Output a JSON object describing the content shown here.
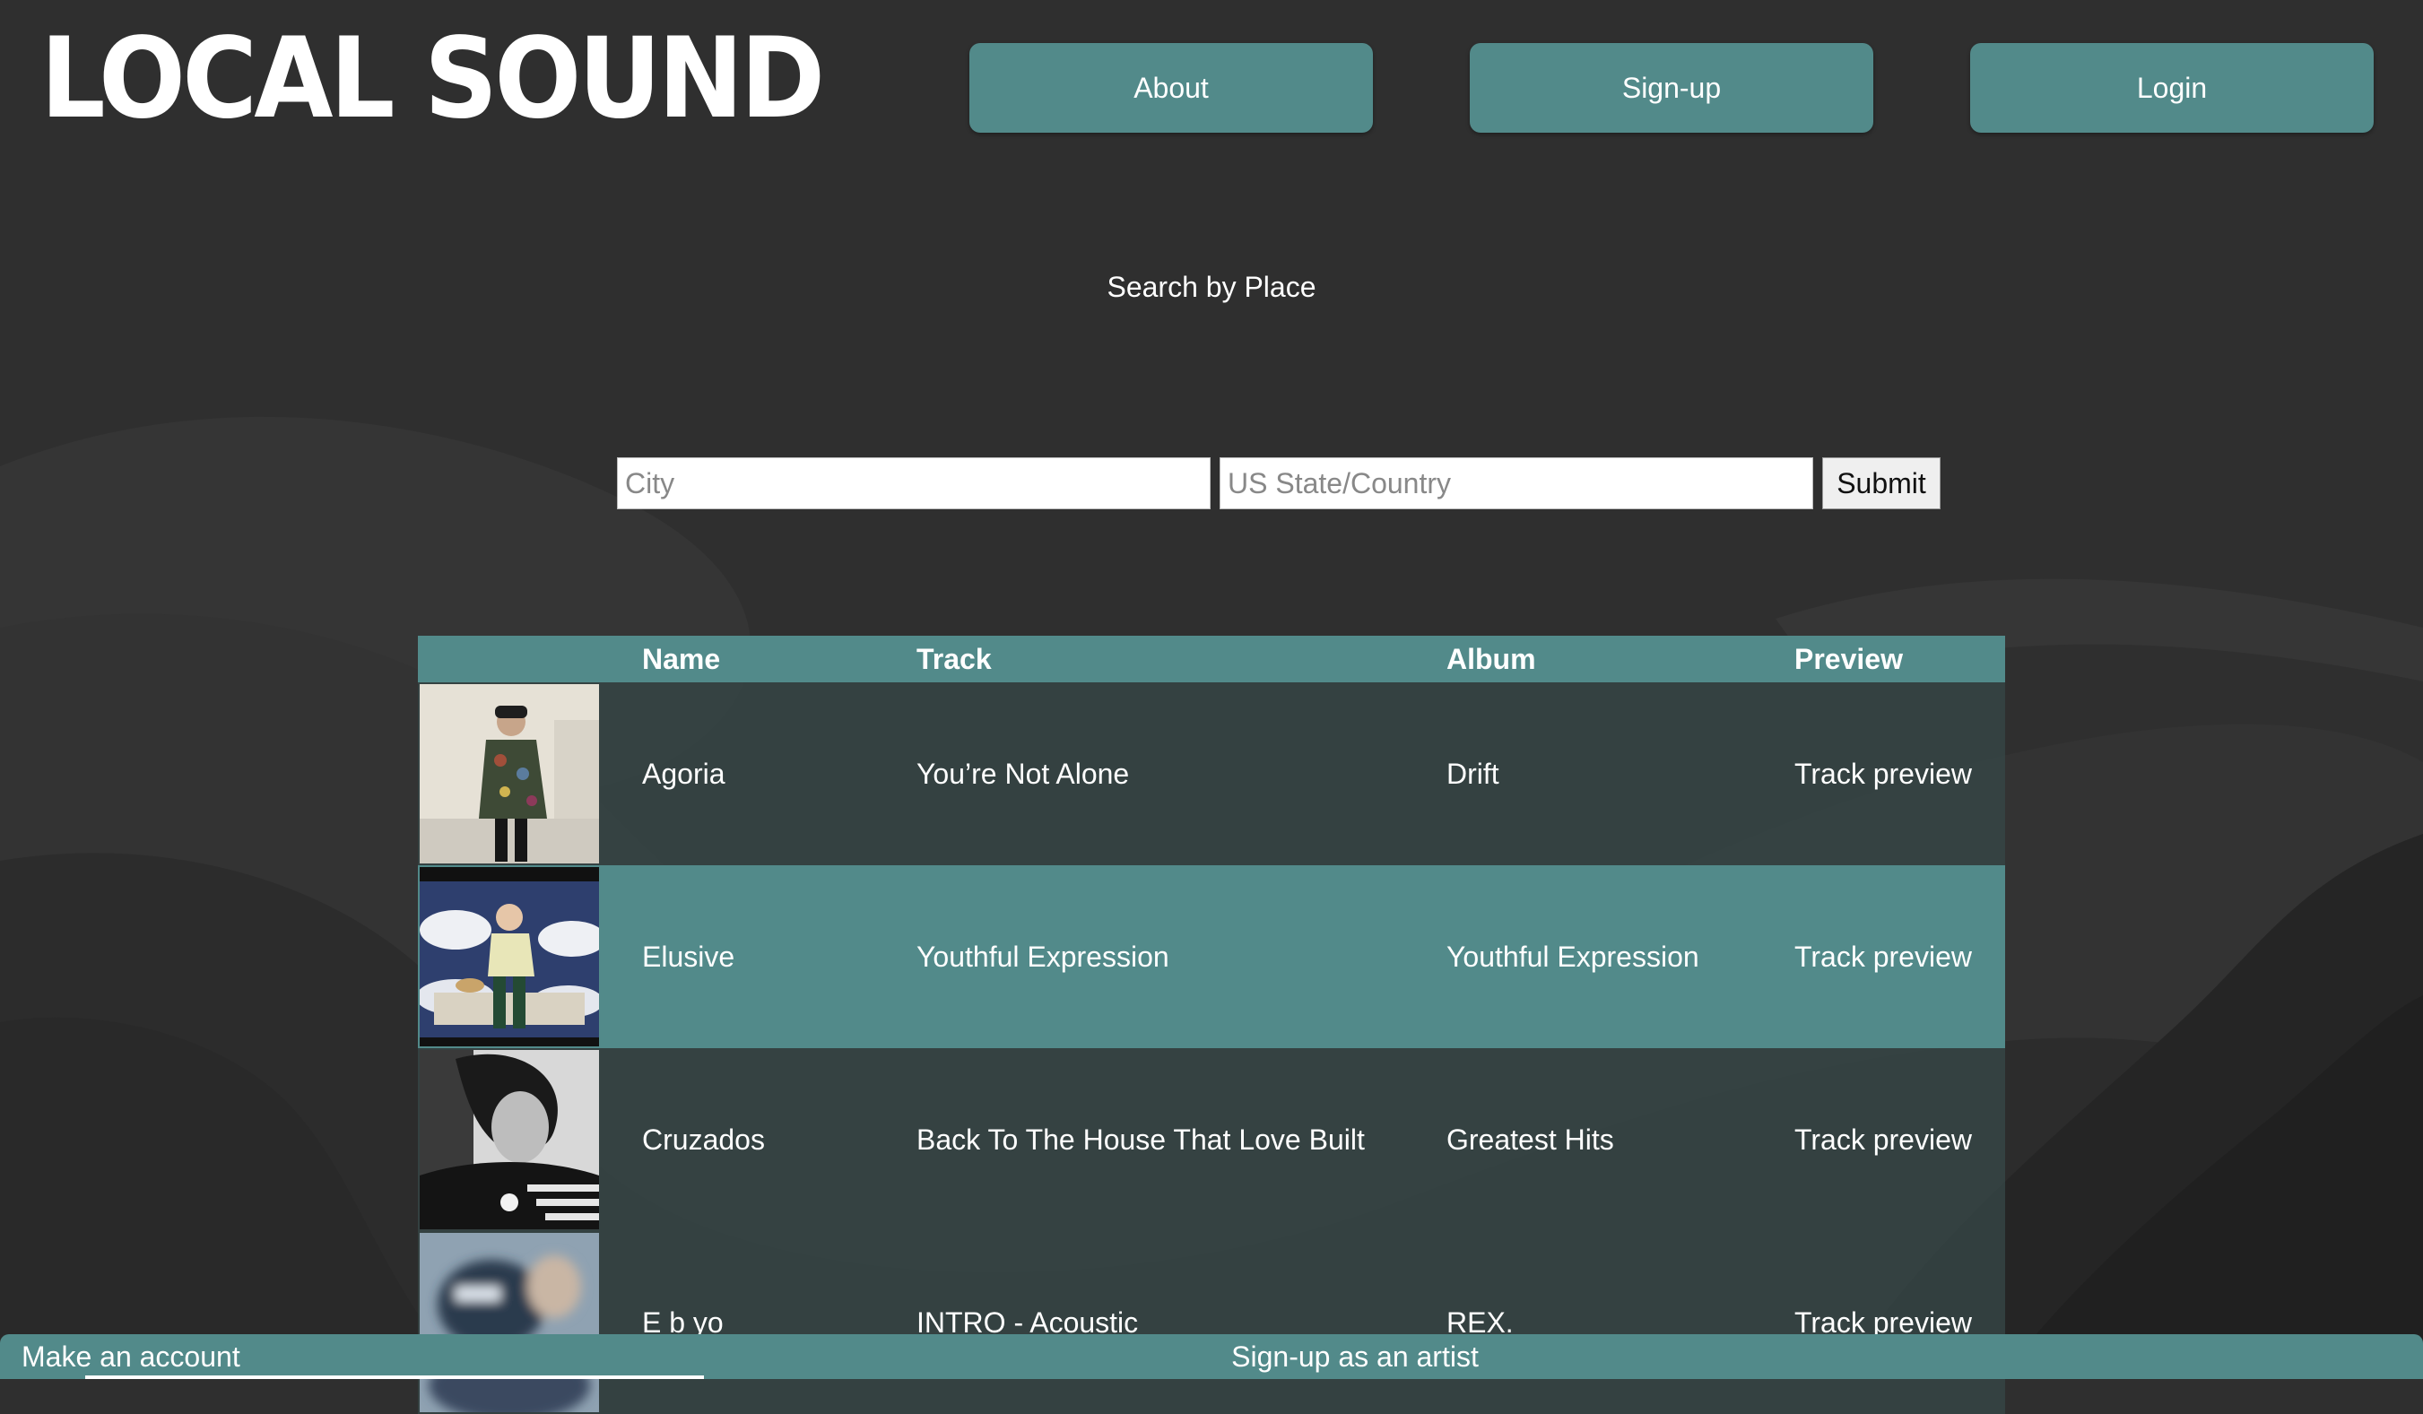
{
  "brand": {
    "logo_text": "LOCAL SOUND"
  },
  "nav": {
    "about": "About",
    "signup": "Sign-up",
    "login": "Login"
  },
  "search": {
    "title": "Search by Place",
    "city_placeholder": "City",
    "state_placeholder": "US State/Country",
    "submit": "Submit"
  },
  "table": {
    "headers": {
      "name": "Name",
      "track": "Track",
      "album": "Album",
      "preview": "Preview"
    },
    "rows": [
      {
        "name": "Agoria",
        "track": "You’re Not Alone",
        "album": "Drift",
        "preview": "Track preview"
      },
      {
        "name": "Elusive",
        "track": "Youthful Expression",
        "album": "Youthful Expression",
        "preview": "Track preview"
      },
      {
        "name": "Cruzados",
        "track": "Back To The House That Love Built",
        "album": "Greatest Hits",
        "preview": "Track preview"
      },
      {
        "name": "E b yo",
        "track": "INTRO - Acoustic",
        "album": "REX.",
        "preview": "Track preview"
      }
    ]
  },
  "footer": {
    "make_account": "Make an account",
    "signup_artist": "Sign-up as an artist"
  },
  "colors": {
    "background": "#2f2f2f",
    "accent": "#528a8a",
    "row_dark": "#364646",
    "text": "#ffffff"
  }
}
